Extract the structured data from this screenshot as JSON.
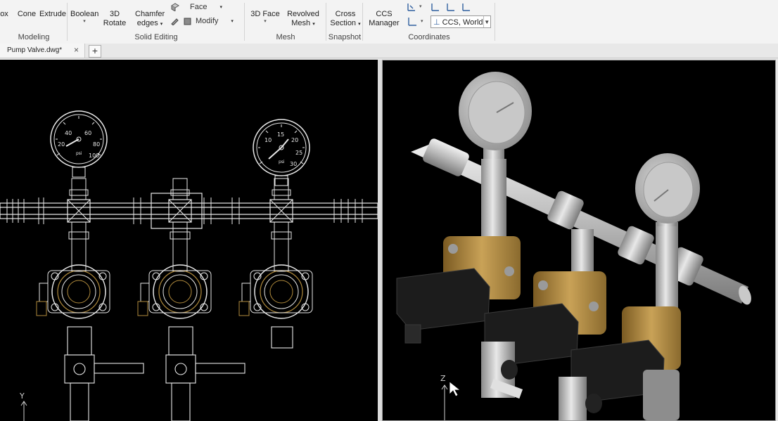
{
  "ribbon": {
    "modeling": {
      "label": "Modeling",
      "buttons": [
        {
          "label": "ox",
          "icon": "box-icon"
        },
        {
          "label": "Cone",
          "icon": "cone-icon"
        },
        {
          "label": "Extrude",
          "icon": "extrude-icon"
        }
      ]
    },
    "solid_editing": {
      "label": "Solid Editing",
      "boolean": "Boolean",
      "rotate3d": "3D Rotate",
      "chamfer_line1": "Chamfer",
      "chamfer_line2": "edges",
      "face": "Face",
      "modify": "Modify"
    },
    "mesh": {
      "label": "Mesh",
      "face3d": "3D Face",
      "revolved_line1": "Revolved",
      "revolved_line2": "Mesh"
    },
    "snapshot": {
      "label": "Snapshot",
      "cross_line1": "Cross",
      "cross_line2": "Section"
    },
    "coordinates": {
      "label": "Coordinates",
      "ccs_line1": "CCS",
      "ccs_line2": "Manager",
      "ccs_value": "CCS, World"
    }
  },
  "tabs": {
    "document": "Pump Valve.dwg*",
    "close_symbol": "×",
    "new_symbol": "+"
  },
  "viewports": {
    "left_axis": "Y",
    "right_axis": "Z"
  },
  "gauges_left": [
    {
      "ticks": [
        "20",
        "40",
        "60",
        "80",
        "100"
      ],
      "unit": "psi"
    },
    {
      "ticks": [
        "10",
        "15",
        "20",
        "25",
        "30"
      ],
      "unit": "psi"
    }
  ],
  "colors": {
    "ribbon_bg": "#f3f3f3",
    "viewport_bg": "#000000",
    "wire": "#e8e8e8",
    "brass": "#b08a3c",
    "steel": "#bdbdbd",
    "actuator": "#1c1c1c"
  }
}
